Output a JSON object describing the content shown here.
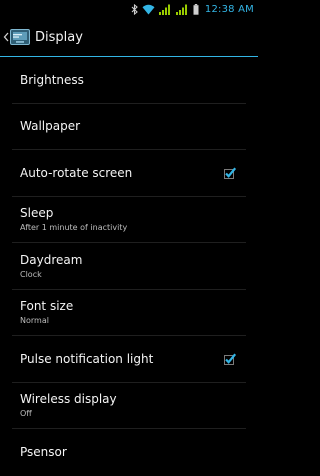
{
  "status_bar": {
    "time": "12:38 AM",
    "accent_color": "#33b5e5",
    "icons": [
      "bluetooth-icon",
      "wifi-icon",
      "signal-icon",
      "signal-icon",
      "battery-icon"
    ]
  },
  "action_bar": {
    "title": "Display",
    "up_icon": "chevron-left-icon",
    "app_icon": "display-settings-icon",
    "divider_color": "#33b5e5"
  },
  "settings": {
    "items": [
      {
        "label": "Brightness",
        "summary": null,
        "checkbox": null
      },
      {
        "label": "Wallpaper",
        "summary": null,
        "checkbox": null
      },
      {
        "label": "Auto-rotate screen",
        "summary": null,
        "checkbox": true
      },
      {
        "label": "Sleep",
        "summary": "After 1 minute of inactivity",
        "checkbox": null
      },
      {
        "label": "Daydream",
        "summary": "Clock",
        "checkbox": null
      },
      {
        "label": "Font size",
        "summary": "Normal",
        "checkbox": null
      },
      {
        "label": "Pulse notification light",
        "summary": null,
        "checkbox": true
      },
      {
        "label": "Wireless display",
        "summary": "Off",
        "checkbox": null
      },
      {
        "label": "Psensor",
        "summary": null,
        "checkbox": null
      }
    ]
  }
}
